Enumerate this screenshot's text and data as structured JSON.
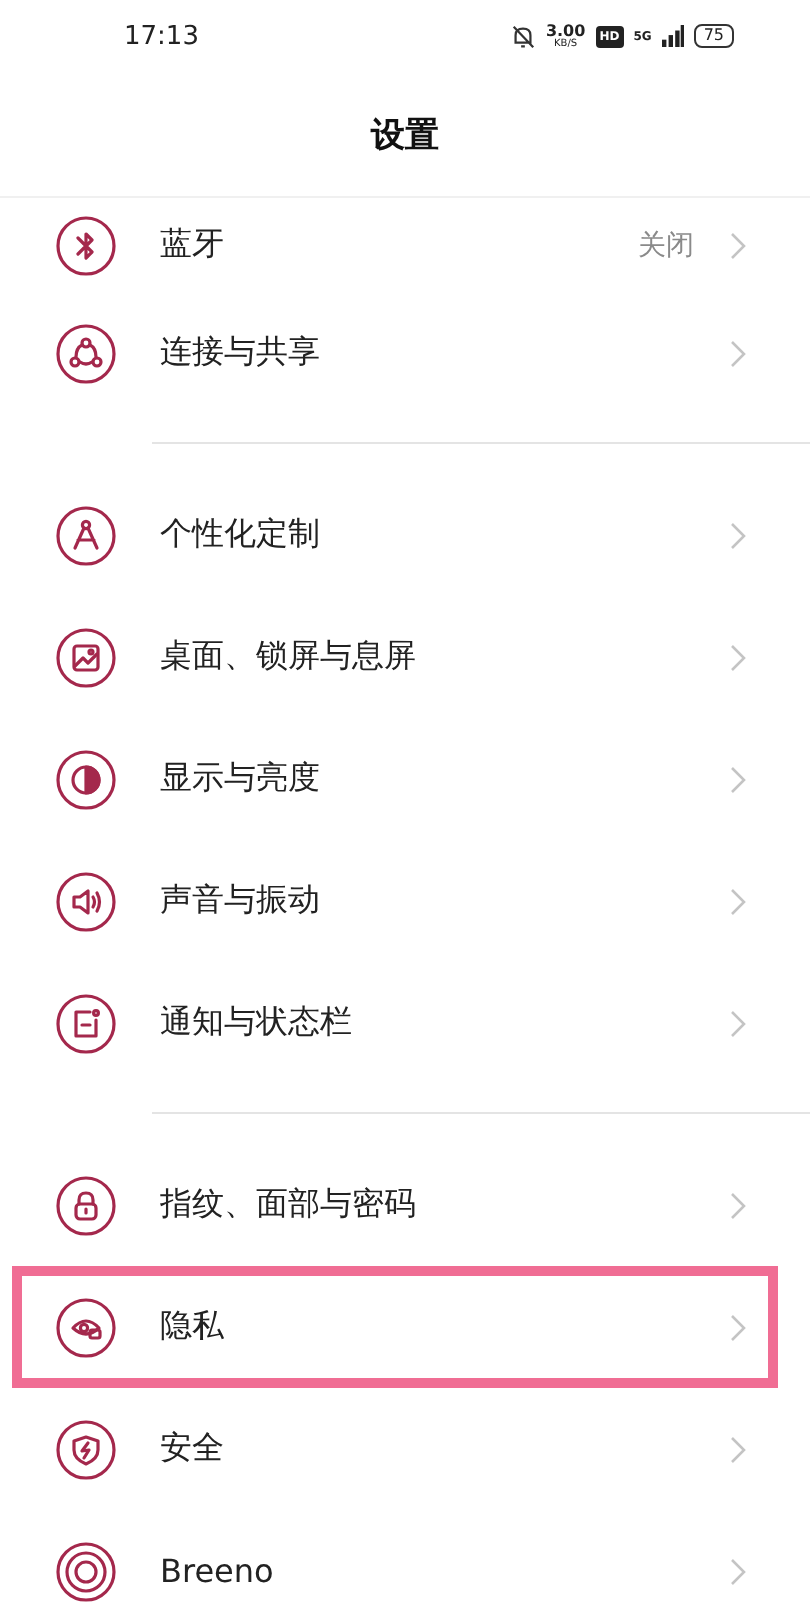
{
  "status_bar": {
    "time": "17:13",
    "speed_value": "3.00",
    "speed_unit": "KB/S",
    "hd_badge": "HD",
    "network": "5G",
    "battery": "75"
  },
  "title": "设置",
  "sections": [
    {
      "items": [
        {
          "kind": "bluetooth",
          "label": "蓝牙",
          "value": "关闭",
          "highlighted": false
        },
        {
          "kind": "share",
          "label": "连接与共享",
          "highlighted": false
        }
      ]
    },
    {
      "items": [
        {
          "kind": "personalize",
          "label": "个性化定制",
          "highlighted": false
        },
        {
          "kind": "wallpaper",
          "label": "桌面、锁屏与息屏",
          "highlighted": false
        },
        {
          "kind": "display",
          "label": "显示与亮度",
          "highlighted": false
        },
        {
          "kind": "sound",
          "label": "声音与振动",
          "highlighted": false
        },
        {
          "kind": "notification",
          "label": "通知与状态栏",
          "highlighted": false
        }
      ]
    },
    {
      "items": [
        {
          "kind": "lock",
          "label": "指纹、面部与密码",
          "highlighted": false
        },
        {
          "kind": "privacy",
          "label": "隐私",
          "highlighted": true
        },
        {
          "kind": "security",
          "label": "安全",
          "highlighted": false
        },
        {
          "kind": "breeno",
          "label": "Breeno",
          "highlighted": false
        }
      ]
    }
  ]
}
